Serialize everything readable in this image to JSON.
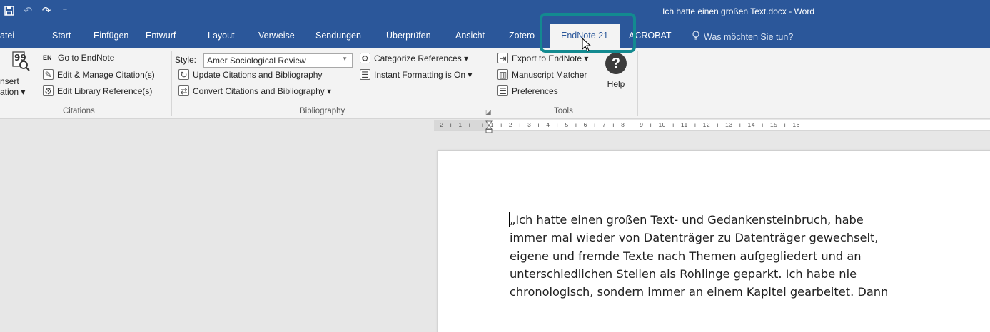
{
  "window": {
    "title": "Ich hatte einen großen Text.docx - Word"
  },
  "qat": {
    "qat_icons": [
      "save-icon",
      "undo-icon",
      "redo-icon",
      "customize-qat-icon"
    ]
  },
  "tabs": [
    {
      "label": "atei"
    },
    {
      "label": "Start"
    },
    {
      "label": "Einfügen"
    },
    {
      "label": "Entwurf"
    },
    {
      "label": "Layout"
    },
    {
      "label": "Verweise"
    },
    {
      "label": "Sendungen"
    },
    {
      "label": "Überprüfen"
    },
    {
      "label": "Ansicht"
    },
    {
      "label": "Zotero"
    },
    {
      "label": "EndNote 21",
      "active": true
    },
    {
      "label": "ACROBAT"
    }
  ],
  "tell_me": {
    "placeholder": "Was möchten Sie tun?"
  },
  "ribbon": {
    "citations": {
      "insert_label_line1": "nsert",
      "insert_label_line2": "ation ▾",
      "go_to_endnote": "Go to EndNote",
      "edit_manage": "Edit & Manage Citation(s)",
      "edit_library": "Edit Library Reference(s)",
      "group_label": "Citations"
    },
    "bibliography": {
      "style_label": "Style:",
      "style_value": "Amer Sociological Review",
      "update": "Update Citations and Bibliography",
      "convert": "Convert Citations and Bibliography ▾",
      "categorize": "Categorize References ▾",
      "instant_formatting": "Instant Formatting is On ▾",
      "group_label": "Bibliography"
    },
    "tools": {
      "export": "Export to EndNote ▾",
      "manuscript_matcher": "Manuscript Matcher",
      "preferences": "Preferences",
      "help": "Help",
      "group_label": "Tools"
    }
  },
  "ruler": {
    "text": "· 2 · ı · 1 · ı ·   · ı · 1 · ı · 2 · ı · 3 · ı · 4 · ı · 5 · ı · 6 · ı · 7 · ı · 8 · ı · 9 · ı · 10 · ı · 11 · ı · 12 · ı · 13 · ı · 14 · ı · 15 · ı · 16"
  },
  "document": {
    "lines": [
      "„Ich hatte einen großen Text- und Gedankensteinbruch, habe",
      "immer mal wieder von Datenträger zu Datenträger gewechselt,",
      "eigene und fremde Texte nach Themen aufgegliedert und an",
      "unterschiedlichen Stellen als Rohlinge geparkt. Ich habe nie",
      "chronologisch, sondern immer an einem Kapitel gearbeitet. Dann"
    ]
  }
}
